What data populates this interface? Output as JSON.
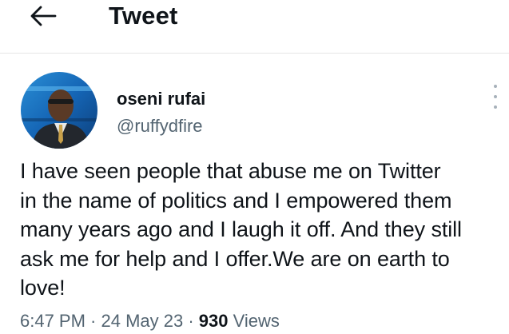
{
  "header": {
    "back_icon": "arrow-left-icon",
    "title": "Tweet"
  },
  "tweet": {
    "author": {
      "display_name": "oseni rufai",
      "handle": "@ruffydfire",
      "avatar_icon": "profile-photo"
    },
    "more_icon": "more-vertical-icon",
    "text": "I have seen people that abuse me on Twitter\nin the name of politics and I empowered them\nmany years ago and I laugh it off. And they still\nask me for help and I offer.We are on earth to\nlove!",
    "time": "6:47 PM",
    "separator": " · ",
    "date": "24 May 23",
    "views_count": "930",
    "views_label": " Views"
  },
  "colors": {
    "text_primary": "#0f1419",
    "text_secondary": "#536471",
    "divider": "#e6e6e6",
    "background": "#ffffff"
  }
}
